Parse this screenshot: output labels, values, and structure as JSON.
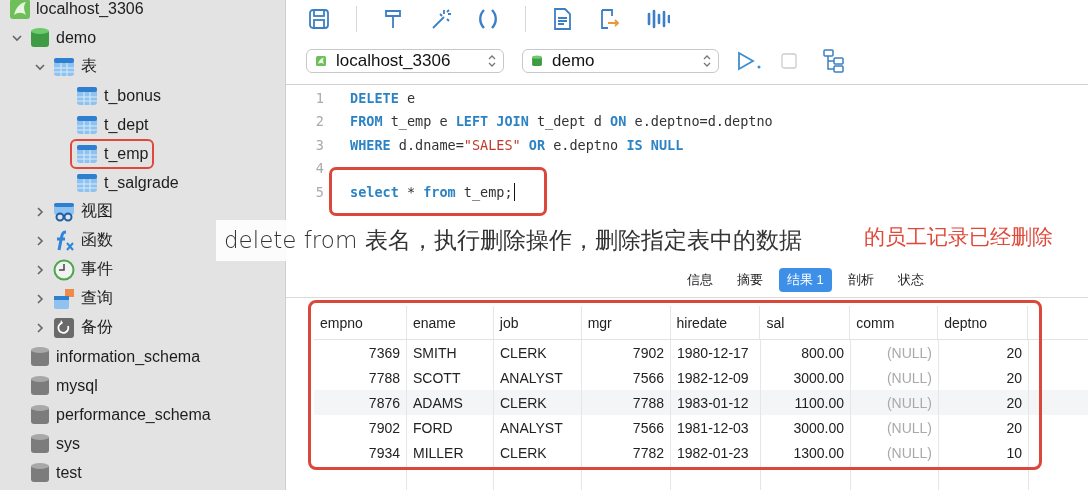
{
  "sidebar": {
    "tree": [
      {
        "name": "localhost_3306",
        "kind": "connection",
        "children": [
          {
            "name": "demo",
            "kind": "database",
            "expanded": true,
            "children": [
              {
                "name": "表",
                "kind": "tables",
                "expanded": true,
                "children": [
                  {
                    "name": "t_bonus",
                    "kind": "table",
                    "highlighted": false
                  },
                  {
                    "name": "t_dept",
                    "kind": "table",
                    "highlighted": false
                  },
                  {
                    "name": "t_emp",
                    "kind": "table",
                    "highlighted": true
                  },
                  {
                    "name": "t_salgrade",
                    "kind": "table",
                    "highlighted": false
                  }
                ]
              },
              {
                "name": "视图",
                "kind": "views",
                "expanded": false
              },
              {
                "name": "函数",
                "kind": "functions",
                "expanded": false
              },
              {
                "name": "事件",
                "kind": "events",
                "expanded": false
              },
              {
                "name": "查询",
                "kind": "queries",
                "expanded": false
              },
              {
                "name": "备份",
                "kind": "backups",
                "expanded": false
              }
            ]
          },
          {
            "name": "information_schema",
            "kind": "database-off"
          },
          {
            "name": "mysql",
            "kind": "database-off"
          },
          {
            "name": "performance_schema",
            "kind": "database-off"
          },
          {
            "name": "sys",
            "kind": "database-off"
          },
          {
            "name": "test",
            "kind": "database-off"
          }
        ]
      }
    ]
  },
  "selectors": [
    {
      "kind": "connection",
      "value": "localhost_3306"
    },
    {
      "kind": "database",
      "value": "demo"
    }
  ],
  "editor": {
    "lines": [
      {
        "number": "1",
        "highlighted": false,
        "cursor": false,
        "tokens": [
          {
            "kind": "keyword",
            "text": "DELETE"
          },
          {
            "kind": "plain",
            "text": " e"
          }
        ]
      },
      {
        "number": "2",
        "highlighted": false,
        "cursor": false,
        "tokens": [
          {
            "kind": "keyword",
            "text": "FROM"
          },
          {
            "kind": "plain",
            "text": " t_emp e "
          },
          {
            "kind": "keyword",
            "text": "LEFT JOIN"
          },
          {
            "kind": "plain",
            "text": " t_dept d "
          },
          {
            "kind": "keyword",
            "text": "ON"
          },
          {
            "kind": "plain",
            "text": " e.deptno=d.deptno"
          }
        ]
      },
      {
        "number": "3",
        "highlighted": false,
        "cursor": false,
        "tokens": [
          {
            "kind": "keyword",
            "text": "WHERE"
          },
          {
            "kind": "plain",
            "text": " d.dname="
          },
          {
            "kind": "string",
            "text": "\"SALES\""
          },
          {
            "kind": "keyword",
            "text": " OR"
          },
          {
            "kind": "plain",
            "text": " e.deptno "
          },
          {
            "kind": "keyword",
            "text": "IS NULL"
          }
        ]
      },
      {
        "number": "4",
        "highlighted": false,
        "cursor": false
      },
      {
        "number": "5",
        "highlighted": true,
        "cursor": true,
        "tokens": [
          {
            "kind": "keyword",
            "text": "select"
          },
          {
            "kind": "plain",
            "text": " * "
          },
          {
            "kind": "keyword",
            "text": "from"
          },
          {
            "kind": "plain",
            "text": " t_emp;"
          }
        ]
      }
    ]
  },
  "annotation": "的员工记录已经删除",
  "caption": "delete from 表名，执行删除操作，删除指定表中的数据",
  "result_tabs": [
    {
      "label": "信息",
      "selected": false
    },
    {
      "label": "摘要",
      "selected": false
    },
    {
      "label": "结果 1",
      "selected": true
    },
    {
      "label": "剖析",
      "selected": false
    },
    {
      "label": "状态",
      "selected": false
    }
  ],
  "table": {
    "highlighted": true,
    "columns": [
      {
        "label": "empno",
        "kind": "number"
      },
      {
        "label": "ename",
        "kind": "text"
      },
      {
        "label": "job",
        "kind": "text"
      },
      {
        "label": "mgr",
        "kind": "number"
      },
      {
        "label": "hiredate",
        "kind": "text"
      },
      {
        "label": "sal",
        "kind": "number"
      },
      {
        "label": "comm",
        "kind": "null"
      },
      {
        "label": "deptno",
        "kind": "number"
      }
    ],
    "rows": [
      [
        "7369",
        "SMITH",
        "CLERK",
        "7902",
        "1980-12-17",
        "800.00",
        "(NULL)",
        "20"
      ],
      [
        "7788",
        "SCOTT",
        "ANALYST",
        "7566",
        "1982-12-09",
        "3000.00",
        "(NULL)",
        "20"
      ],
      [
        "7876",
        "ADAMS",
        "CLERK",
        "7788",
        "1983-01-12",
        "1100.00",
        "(NULL)",
        "20"
      ],
      [
        "7902",
        "FORD",
        "ANALYST",
        "7566",
        "1981-12-03",
        "3000.00",
        "(NULL)",
        "20"
      ],
      [
        "7934",
        "MILLER",
        "CLERK",
        "7782",
        "1982-01-23",
        "1300.00",
        "(NULL)",
        "10"
      ]
    ]
  }
}
